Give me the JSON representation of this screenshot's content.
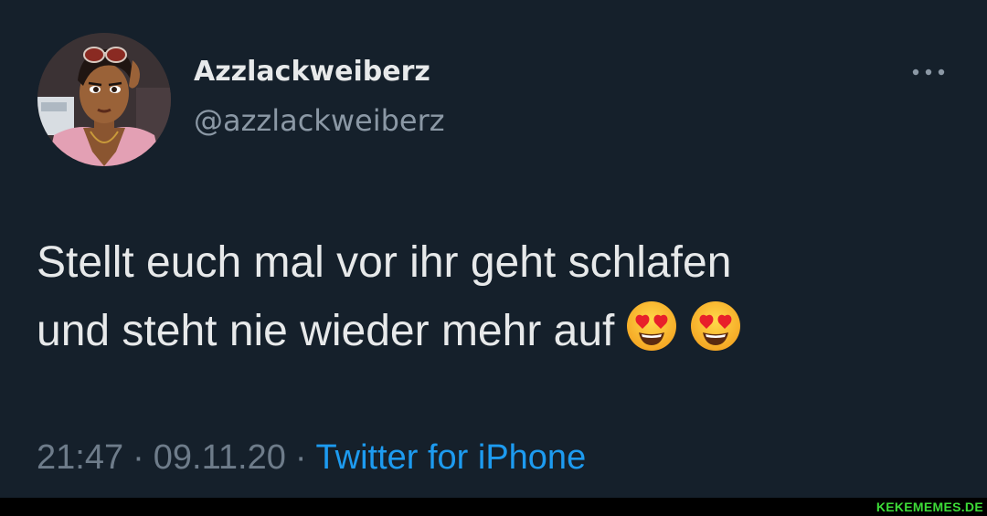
{
  "tweet": {
    "display_name": "Azzlackweiberz",
    "handle": "@azzlackweiberz",
    "more_icon": "more-horizontal-icon",
    "text_lines": [
      "Stellt euch mal vor ihr geht schlafen",
      "und steht nie wieder mehr auf"
    ],
    "emojis": [
      "smiling-face-with-heart-eyes",
      "smiling-face-with-heart-eyes"
    ],
    "time": "21:47",
    "separator": "·",
    "date": "09.11.20",
    "source": "Twitter for iPhone"
  },
  "watermark": "KEKEMEMES.DE",
  "colors": {
    "background": "#15202b",
    "primary_text": "#e7e9ea",
    "secondary_text": "#8b98a5",
    "link": "#1d9bf0",
    "watermark": "#3ddc38"
  }
}
